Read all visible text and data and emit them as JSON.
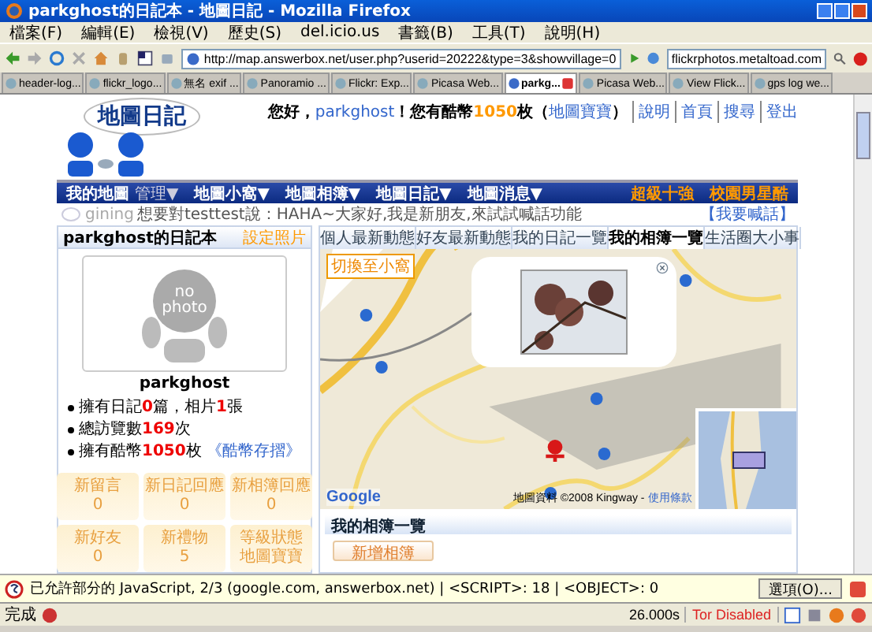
{
  "window": {
    "title": "parkghost的日記本 - 地圖日記 - Mozilla Firefox"
  },
  "menu": [
    "檔案(F)",
    "編輯(E)",
    "檢視(V)",
    "歷史(S)",
    "del.icio.us",
    "書籤(B)",
    "工具(T)",
    "說明(H)"
  ],
  "address": {
    "value": "http://map.answerbox.net/user.php?userid=20222&type=3&showvillage=0"
  },
  "search": {
    "value": "flickrphotos.metaltoad.com"
  },
  "browser_tabs": [
    {
      "label": "header-log...",
      "selected": false
    },
    {
      "label": "flickr_logo...",
      "selected": false
    },
    {
      "label": "無名 exif ...",
      "selected": false
    },
    {
      "label": "Panoramio ...",
      "selected": false
    },
    {
      "label": "Flickr: Exp...",
      "selected": false
    },
    {
      "label": "Picasa Web...",
      "selected": false
    },
    {
      "label": "parkg...",
      "selected": true
    },
    {
      "label": "Picasa Web...",
      "selected": false
    },
    {
      "label": "View Flick...",
      "selected": false
    },
    {
      "label": "gps log we...",
      "selected": false
    }
  ],
  "site": {
    "logo": "地圖日記",
    "greeting": [
      {
        "kind": "text",
        "text": "您好，"
      },
      {
        "kind": "link",
        "text": "parkghost"
      },
      {
        "kind": "text",
        "text": "！您有酷幣"
      },
      {
        "kind": "number",
        "text": "1050"
      },
      {
        "kind": "text",
        "text": "枚（"
      },
      {
        "kind": "link",
        "text": "地圖寶寶"
      },
      {
        "kind": "text",
        "text": "）"
      }
    ],
    "top_links": [
      "說明",
      "首頁",
      "搜尋",
      "登出"
    ],
    "nav": [
      {
        "label": "我的地圖",
        "sub": "管理▼"
      },
      {
        "label": "地圖小窩▼"
      },
      {
        "label": "地圖相簿▼"
      },
      {
        "label": "地圖日記▼"
      },
      {
        "label": "地圖消息▼"
      }
    ],
    "nav_right": [
      "超級十強",
      "校園男星酷"
    ],
    "shout": {
      "user": "gining",
      "text": "想要對testtest說：HAHA~大家好,我是新朋友,來試試喊話功能",
      "action": "【我要喊話】"
    }
  },
  "profile": {
    "title": "parkghost的日記本",
    "action": "設定照片",
    "placeholder": "no photo",
    "name": "parkghost",
    "stats": [
      {
        "text": "擁有日記**0**篇，相片**1**張"
      },
      {
        "text": "總訪覽數**169**次"
      },
      {
        "text": "擁有酷幣**1050**枚",
        "link": "《酷幣存摺》"
      }
    ],
    "tiles": [
      {
        "label": "新留言",
        "value": "0"
      },
      {
        "label": "新日記回應",
        "value": "0"
      },
      {
        "label": "新相簿回應",
        "value": "0"
      },
      {
        "label": "新好友",
        "value": "0"
      },
      {
        "label": "新禮物",
        "value": "5"
      },
      {
        "label": "等級狀態",
        "value": "地圖寶寶"
      }
    ]
  },
  "feed": {
    "tabs": [
      {
        "label": "個人最新動態",
        "selected": false
      },
      {
        "label": "好友最新動態",
        "selected": false
      },
      {
        "label": "我的日記一覽",
        "selected": false
      },
      {
        "label": "我的相簿一覽",
        "selected": true
      },
      {
        "label": "生活圈大小事",
        "selected": false
      }
    ],
    "map": {
      "switch": "切換至小窩",
      "credit": "地圖資料 ©2008 Kingway -",
      "terms": "使用條款",
      "logo": "Google"
    },
    "section": "我的相簿一覽",
    "button": "新增相簿"
  },
  "notification": {
    "text": "已允許部分的 JavaScript, 2/3 (google.com, answerbox.net) | <SCRIPT>: 18 | <OBJECT>: 0",
    "button": "選項(O)..."
  },
  "status": {
    "text": "完成",
    "time": "26.000s",
    "tor": "Tor Disabled"
  }
}
